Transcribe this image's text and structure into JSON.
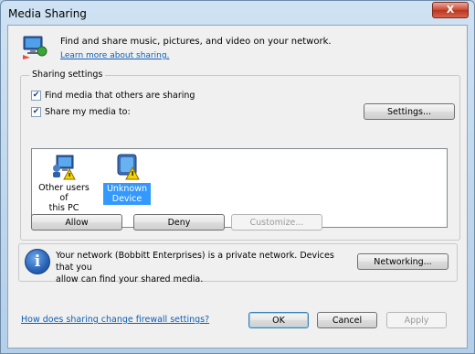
{
  "window": {
    "title": "Media Sharing",
    "close_glyph": "X"
  },
  "intro": {
    "text": "Find and share music, pictures, and video on your network.",
    "link": "Learn more about sharing."
  },
  "sharing_settings": {
    "legend": "Sharing settings",
    "find_media_label": "Find media that others are sharing",
    "find_media_checked": true,
    "share_media_label": "Share my media to:",
    "share_media_checked": true,
    "settings_button": "Settings..."
  },
  "devices": [
    {
      "label_line1": "Other users of",
      "label_line2": "this PC",
      "icon": "computer-users-icon",
      "selected": false
    },
    {
      "label_line1": "Unknown",
      "label_line2": "Device",
      "icon": "unknown-device-icon",
      "selected": true
    }
  ],
  "device_actions": {
    "allow": "Allow",
    "deny": "Deny",
    "customize": "Customize..."
  },
  "network_info": {
    "line1": "Your network (Bobbitt Enterprises) is a private network. Devices that you",
    "line2": "allow can find your shared media.",
    "networking_button": "Networking..."
  },
  "footer": {
    "firewall_link": "How does sharing change firewall settings?",
    "ok": "OK",
    "cancel": "Cancel",
    "apply": "Apply"
  }
}
